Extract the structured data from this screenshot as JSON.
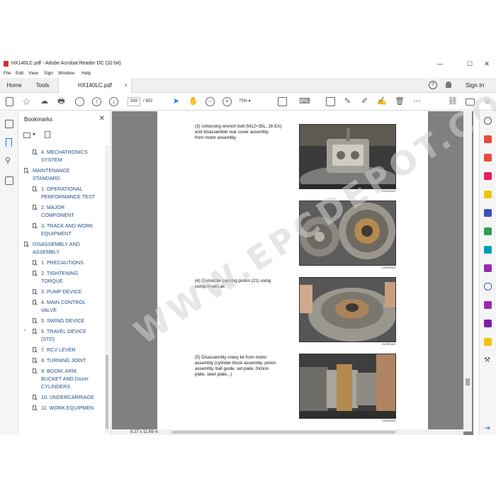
{
  "window": {
    "title": "HX140LC.pdf - Adobe Acrobat Reader DC (32-bit)",
    "minimize": "—",
    "maximize": "☐",
    "close": "✕"
  },
  "menu": [
    "File",
    "Edit",
    "View",
    "Sign",
    "Window",
    "Help"
  ],
  "tabs": {
    "home": "Home",
    "tools": "Tools",
    "document": "HX140LC.pdf",
    "close": "×",
    "help": "?",
    "sign_in": "Sign In"
  },
  "toolbar": {
    "current_page": "569",
    "total_pages": "/ 652",
    "zoom": "75%"
  },
  "bookmarks": {
    "title": "Bookmarks",
    "close": "✕",
    "items": [
      {
        "label_lines": [
          "SYSTEM"
        ],
        "level": 2,
        "caret": ""
      },
      {
        "label_lines": [
          "4. MECHATRONICS",
          "SYSTEM"
        ],
        "level": 2,
        "caret": ""
      },
      {
        "label_lines": [
          "MAINTENANCE",
          "STANDARD"
        ],
        "level": 1,
        "caret": "⌄"
      },
      {
        "label_lines": [
          "1. OPERATIONAL",
          "PERFORMANCE TEST"
        ],
        "level": 2,
        "caret": ""
      },
      {
        "label_lines": [
          "2. MAJOR",
          "COMPONENT"
        ],
        "level": 2,
        "caret": ""
      },
      {
        "label_lines": [
          "3. TRACK AND WORK",
          "EQUIPMENT"
        ],
        "level": 2,
        "caret": ""
      },
      {
        "label_lines": [
          "DISASSEMBLY AND",
          "ASSEMBLY"
        ],
        "level": 1,
        "caret": "⌄"
      },
      {
        "label_lines": [
          "1. PRECAUTIONS"
        ],
        "level": 2,
        "caret": ""
      },
      {
        "label_lines": [
          "2. TIGHTENING",
          "TORQUE"
        ],
        "level": 2,
        "caret": ""
      },
      {
        "label_lines": [
          "3. PUMP DEVICE"
        ],
        "level": 2,
        "caret": ""
      },
      {
        "label_lines": [
          "4. MAIN CONTROL",
          "VALVE"
        ],
        "level": 2,
        "caret": ""
      },
      {
        "label_lines": [
          "5. SWING DEVICE"
        ],
        "level": 2,
        "caret": ""
      },
      {
        "label_lines": [
          "6. TRAVEL DEVICE",
          "(STD)"
        ],
        "level": 2,
        "caret": "›"
      },
      {
        "label_lines": [
          "7. RCV LEVER"
        ],
        "level": 2,
        "caret": ""
      },
      {
        "label_lines": [
          "8. TURNING JOINT"
        ],
        "level": 2,
        "caret": ""
      },
      {
        "label_lines": [
          "9. BOOM, ARM,",
          "BUCKET AND Dozer",
          "CYLINDERS"
        ],
        "level": 2,
        "caret": ""
      },
      {
        "label_lines": [
          "10. UNDERCARRIAGE"
        ],
        "level": 2,
        "caret": ""
      },
      {
        "label_lines": [
          "11. WORK EQUIPMEN"
        ],
        "level": 2,
        "caret": ""
      }
    ]
  },
  "document": {
    "steps": [
      {
        "lines": [
          "(3) Unloosing wrench bolt (M12×35L, 16 EA)",
          "and disassemble rear cover assembly",
          "from motor assembly."
        ]
      },
      {
        "lines": [
          "(4) Dismantle packing piston (21) using",
          "compressed air."
        ]
      },
      {
        "lines": [
          "(5) Disassembly rotary kit from motor",
          "assembly (cylinder block assembly, piston",
          "assembly, ball guide, set plate, friction",
          "plate, steel plate...)"
        ]
      }
    ],
    "captions": [
      "21078TM23",
      "21078TM24",
      "21078TM25",
      "21078TM26"
    ],
    "watermark": "WWW.EPCDEPOT.COM",
    "page_size": "8.27 x 11.69 in"
  },
  "colors": {
    "bookmark_text": "#1e4e8c",
    "doc_background": "#808080",
    "accent_blue": "#1a73e8"
  }
}
